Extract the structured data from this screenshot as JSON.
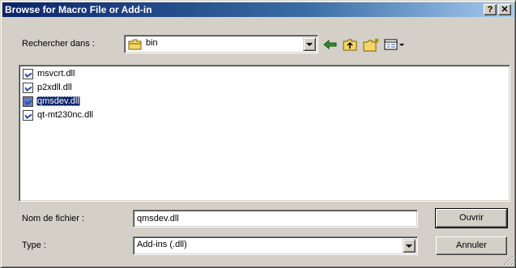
{
  "window": {
    "title": "Browse for Macro File or Add-in",
    "help_label": "?",
    "close_label": "✕"
  },
  "look_in": {
    "label": "Rechercher dans :",
    "value": "bin"
  },
  "toolbar": {
    "icons": [
      "back-arrow-icon",
      "up-folder-icon",
      "new-folder-icon",
      "view-menu-icon"
    ]
  },
  "files": [
    {
      "name": "msvcrt.dll",
      "selected": false
    },
    {
      "name": "p2xdll.dll",
      "selected": false
    },
    {
      "name": "qmsdev.dll",
      "selected": true
    },
    {
      "name": "qt-mt230nc.dll",
      "selected": false
    }
  ],
  "filename": {
    "label": "Nom de fichier :",
    "value": "qmsdev.dll"
  },
  "filetype": {
    "label": "Type :",
    "value": "Add-ins (.dll)"
  },
  "buttons": {
    "open": "Ouvrir",
    "cancel": "Annuler"
  },
  "colors": {
    "title_start": "#0a246a",
    "title_end": "#a6caf0",
    "face": "#d4d0c8",
    "selection": "#0a246a",
    "folder": "#f3d667"
  }
}
